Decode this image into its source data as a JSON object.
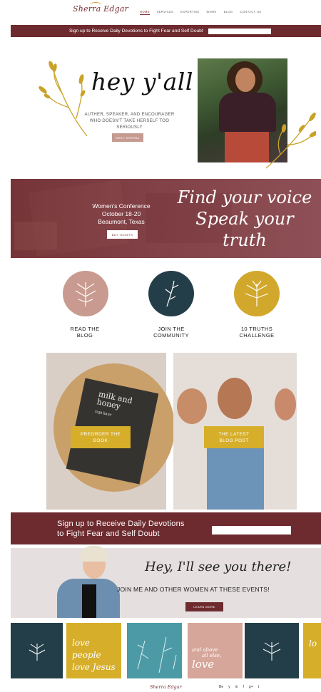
{
  "header": {
    "logo": "Sherra Edgar",
    "nav": [
      "HOME",
      "SERVICES",
      "EXPERTISE",
      "WORK",
      "BLOG",
      "CONTACT US"
    ]
  },
  "signup_top": {
    "text": "Sign up to Receive Daily Devotions to Fight Fear and Self Doubt",
    "input_placeholder": ""
  },
  "hero": {
    "headline": "hey y'all",
    "subtitle_line1": "AUTHER, SPEAKER, AND ENCOURAGER",
    "subtitle_line2": "WHO DOESN'T TAKE HERSELF TOO SERIOUSLY",
    "button": "MEET SHERRA"
  },
  "conference": {
    "line1": "Women's Conference",
    "line2": "October 18-20",
    "line3": "Beaumont, Texas",
    "button": "BUY TICKETS",
    "script_line1": "Find your voice",
    "script_line2": "Speak your truth"
  },
  "features": [
    {
      "line1": "READ THE",
      "line2": "BLOG"
    },
    {
      "line1": "JOIN THE",
      "line2": "COMMUNITY"
    },
    {
      "line1": "10 TRUTHS",
      "line2": "CHALLENGE"
    }
  ],
  "promos": {
    "book_title_1": "milk and",
    "book_title_2": "honey",
    "book_author": "rupi kaur",
    "left_button_1": "PREORDER THE",
    "left_button_2": "BOOK",
    "right_button_1": "THE LATEST",
    "right_button_2": "BLOG POST"
  },
  "signup_bottom": {
    "line1": "Sign up to Receive Daily Devotions",
    "line2": "to Fight Fear and Self Doubt"
  },
  "events": {
    "script": "Hey, I'll see you there!",
    "headline": "JOIN ME AND OTHER WOMEN AT THESE EVENTS!",
    "button": "LEARN MORE"
  },
  "tiles": {
    "t2_line1": "love people",
    "t2_line2": "love Jesus",
    "t4_line1": "and above",
    "t4_line2": "all else,",
    "t4_line3": "love",
    "t6": "lo"
  },
  "footer": {
    "logo": "Sherra Edgar",
    "social": [
      "Be",
      "y",
      "in",
      "f",
      "g+",
      "t"
    ]
  },
  "colors": {
    "maroon": "#6e2b2f",
    "blush": "#c99a8f",
    "navy": "#243e49",
    "mustard": "#d6ae2a"
  }
}
